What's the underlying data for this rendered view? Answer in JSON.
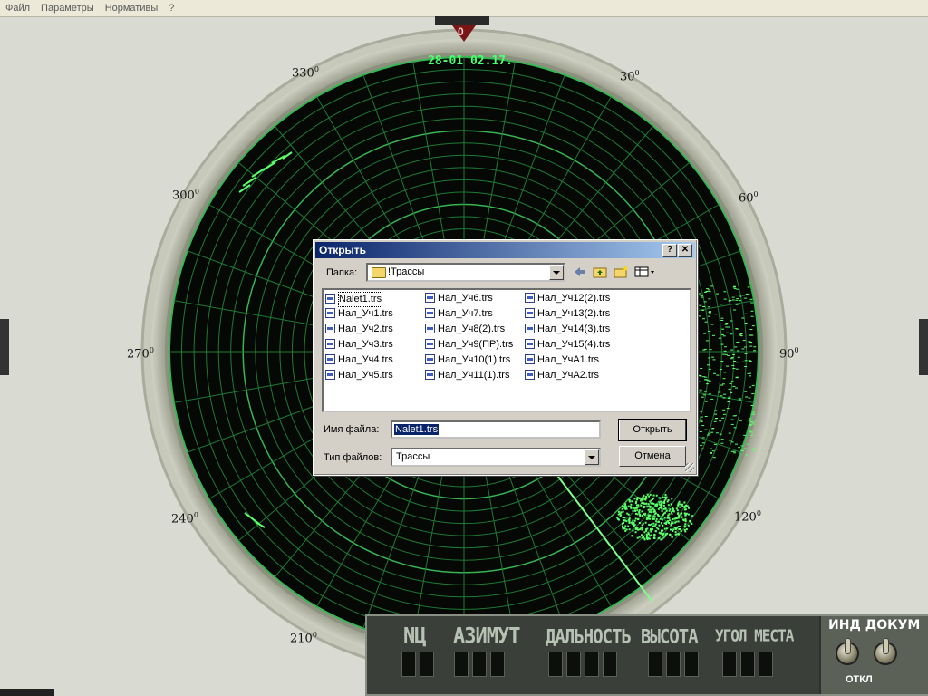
{
  "menu": [
    "Файл",
    "Параметры",
    "Нормативы",
    "?"
  ],
  "radar": {
    "north_label": "0",
    "datetime": "28-01 02.17.",
    "angles": [
      {
        "text": "330",
        "sup": "0"
      },
      {
        "text": "30",
        "sup": "0"
      },
      {
        "text": "300",
        "sup": "0"
      },
      {
        "text": "60",
        "sup": "0"
      },
      {
        "text": "270",
        "sup": "0"
      },
      {
        "text": "90",
        "sup": "0"
      },
      {
        "text": "240",
        "sup": "0"
      },
      {
        "text": "120",
        "sup": "0"
      },
      {
        "text": "210",
        "sup": "0"
      }
    ],
    "colors": {
      "grid": "#2ea84a",
      "screen": "#050805",
      "blip": "#5dff6a"
    }
  },
  "panel": {
    "labels": [
      "NЦ",
      "АЗИМУТ",
      "ДАЛЬНОСТЬ",
      "ВЫСОТА",
      "УГОЛ МЕСТА"
    ],
    "ind_title": "ИНД ДОКУМ",
    "otkl": "ОТКЛ"
  },
  "dialog": {
    "title": "Открыть",
    "help_btn": "?",
    "close_btn": "✕",
    "folder_label": "Папка:",
    "folder_value": "!Трассы",
    "files": [
      [
        "Nalet1.trs",
        "Нал_Уч1.trs",
        "Нал_Уч2.trs",
        "Нал_Уч3.trs",
        "Нал_Уч4.trs",
        "Нал_Уч5.trs"
      ],
      [
        "Нал_Уч6.trs",
        "Нал_Уч7.trs",
        "Нал_Уч8(2).trs",
        "Нал_Уч9(ПР).trs",
        "Нал_Уч10(1).trs",
        "Нал_Уч11(1).trs"
      ],
      [
        "Нал_Уч12(2).trs",
        "Нал_Уч13(2).trs",
        "Нал_Уч14(3).trs",
        "Нал_Уч15(4).trs",
        "Нал_УчА1.trs",
        "Нал_УчА2.trs"
      ]
    ],
    "filename_label": "Имя файла:",
    "filename_value": "Nalet1.trs",
    "filetype_label": "Тип файлов:",
    "filetype_value": "Трассы",
    "open_btn": "Открыть",
    "cancel_btn": "Отмена"
  }
}
